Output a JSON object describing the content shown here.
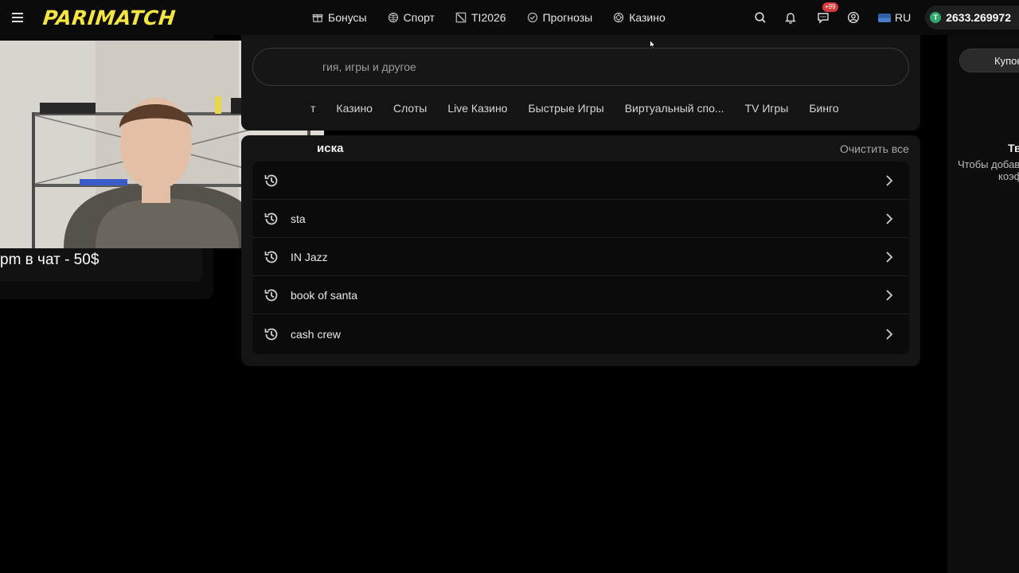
{
  "header": {
    "logo": "PARIMATCH",
    "nav": [
      {
        "label": "Бонусы",
        "icon": "gift-icon"
      },
      {
        "label": "Спорт",
        "icon": "ball-icon"
      },
      {
        "label": "TI2026",
        "icon": "dota-icon"
      },
      {
        "label": "Прогнозы",
        "icon": "check-circle-icon"
      },
      {
        "label": "Казино",
        "icon": "casino-chip-icon"
      }
    ],
    "chat_badge": "+99",
    "language": "RU",
    "balance": "2633.269972",
    "balance_coin": "T"
  },
  "stream_overlay": {
    "promo_text": "pm в чат - 50$"
  },
  "search": {
    "placeholder": "гия, игры и другое",
    "categories": [
      "т",
      "Казино",
      "Слоты",
      "Live Казино",
      "Быстрые Игры",
      "Виртуальный спо...",
      "TV Игры",
      "Бинго"
    ]
  },
  "history": {
    "title": "иска",
    "clear_label": "Очистить все",
    "items": [
      "",
      "sta",
      "IN Jazz",
      "book of santa",
      "cash crew"
    ]
  },
  "betslip": {
    "coupon_label": "Купон",
    "title": "Тв",
    "hint_line1": "Чтобы добав",
    "hint_line2": "коэф"
  }
}
